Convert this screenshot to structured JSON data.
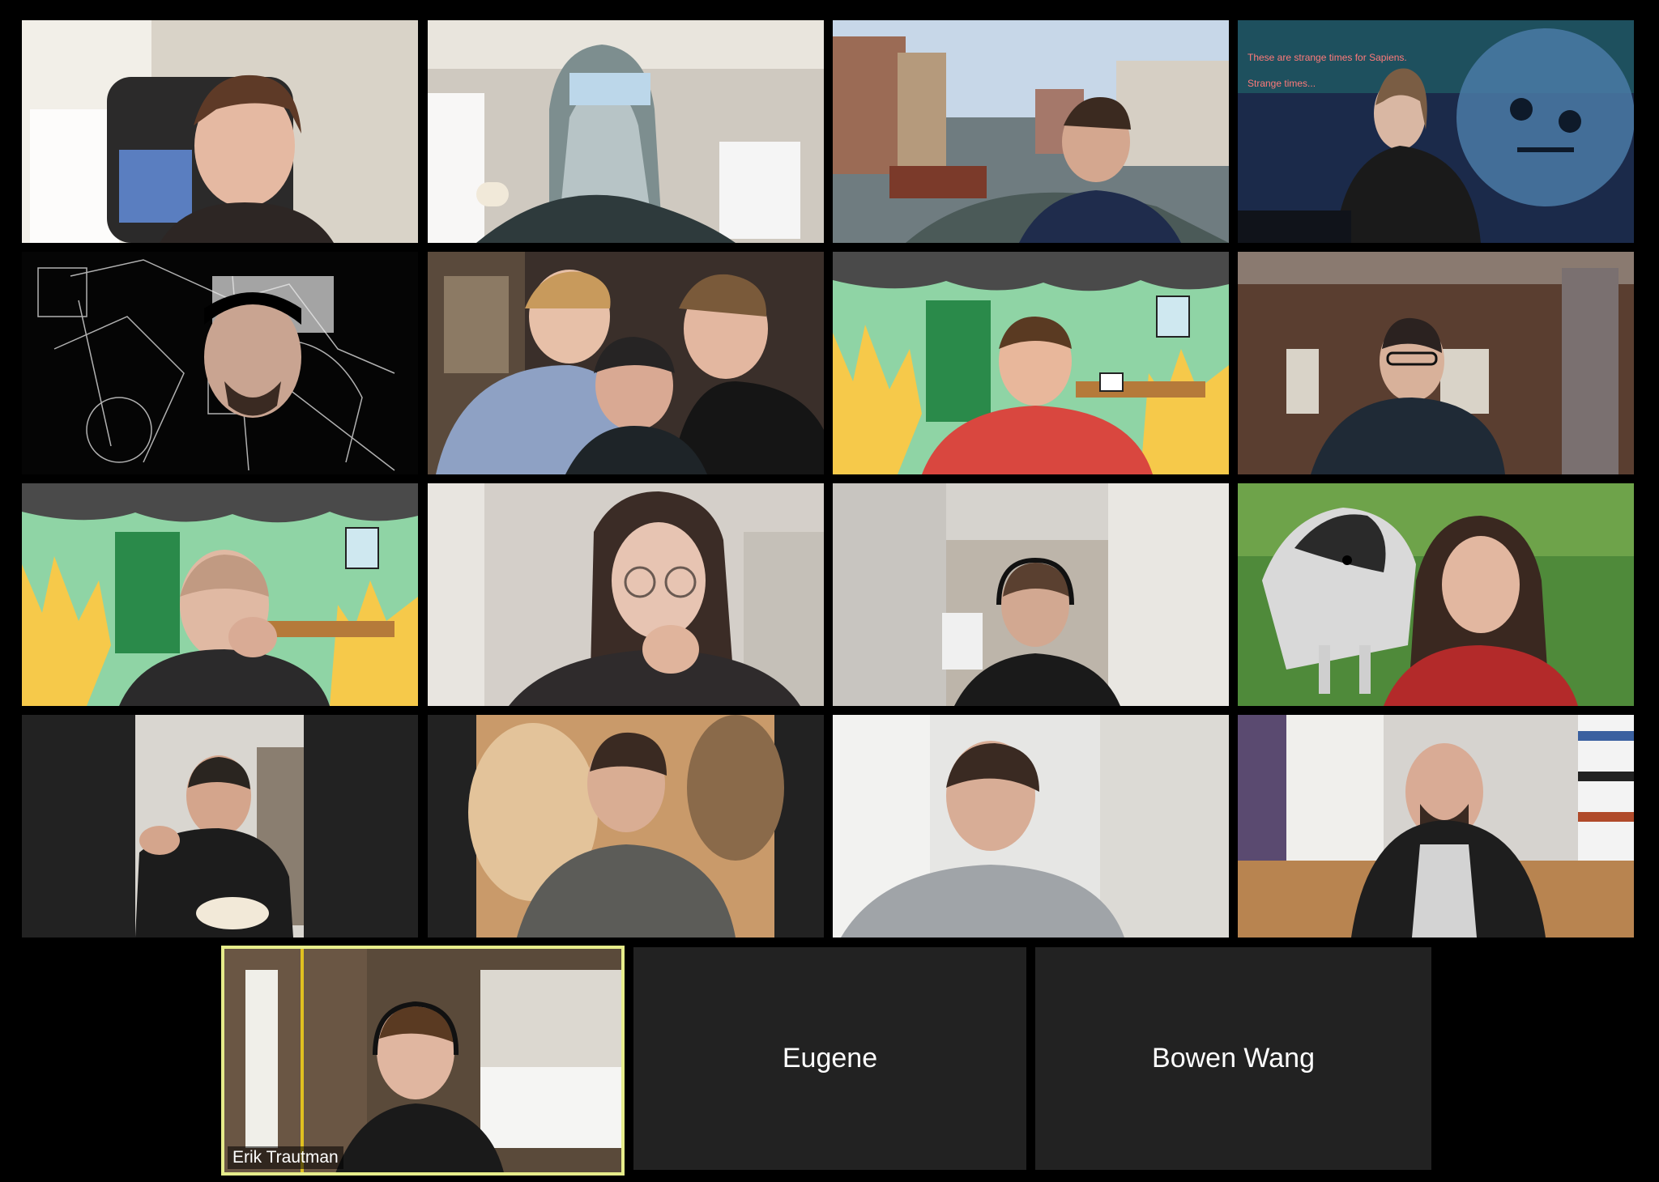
{
  "meeting": {
    "app": "Zoom gallery view",
    "participants_with_video": 17,
    "active_speaker": "Erik Trautman"
  },
  "tiles": {
    "t16": {
      "name": "Erik Trautman"
    },
    "t17": {
      "name": "Eugene"
    },
    "t18": {
      "name": "Bowen Wang"
    }
  },
  "background_text": {
    "line1": "These are strange times for Sapiens.",
    "line2": "Strange times..."
  },
  "colors": {
    "window_bg": "#000000",
    "empty_tile": "#222222",
    "active_border": "#e6ec8a"
  }
}
